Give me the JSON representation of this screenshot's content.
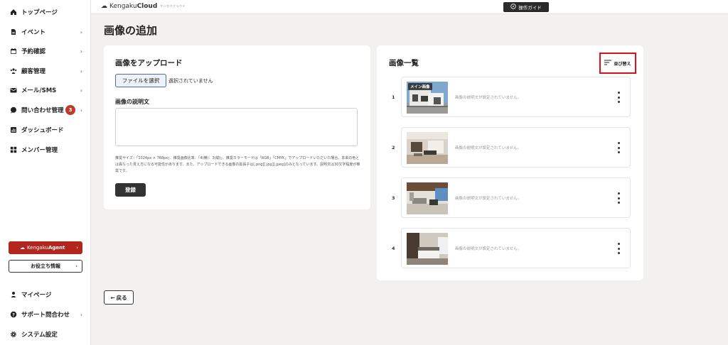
{
  "sidebar": {
    "items": [
      {
        "label": "トップページ",
        "icon": "home-icon",
        "chevron": false
      },
      {
        "label": "イベント",
        "icon": "document-icon",
        "chevron": true
      },
      {
        "label": "予約確認",
        "icon": "calendar-icon",
        "chevron": true
      },
      {
        "label": "顧客管理",
        "icon": "people-icon",
        "chevron": true
      },
      {
        "label": "メール/SMS",
        "icon": "mail-icon",
        "chevron": true
      },
      {
        "label": "問い合わせ管理",
        "icon": "chat-icon",
        "chevron": true,
        "badge": "3"
      },
      {
        "label": "ダッシュボード",
        "icon": "chart-icon",
        "chevron": false
      },
      {
        "label": "メンバー管理",
        "icon": "grid-icon",
        "chevron": false
      }
    ],
    "agent_button": {
      "prefix": "Kengaku",
      "bold": "Agent"
    },
    "info_button": "お役立ち情報",
    "bottom_items": [
      {
        "label": "マイページ",
        "icon": "person-icon",
        "chevron": false
      },
      {
        "label": "サポート問合わせ",
        "icon": "help-icon",
        "chevron": true
      },
      {
        "label": "システム設定",
        "icon": "gear-icon",
        "chevron": false
      }
    ]
  },
  "topbar": {
    "logo_prefix": "Kengaku",
    "logo_bold": "Cloud",
    "logo_sub": "ケンガククラウド",
    "guide_label": "操作ガイド"
  },
  "page": {
    "title": "画像の追加"
  },
  "upload": {
    "title": "画像をアップロード",
    "file_button": "ファイルを選択",
    "file_status": "選択されていません",
    "desc_label": "画像の説明文",
    "note": "推奨サイズ：「1024px × 768px」、推奨画像比率：「4(横)：3(縦)」、推奨カラーモードは「RGB」「CMYK」でアップロードいただいた場合、本来の色とは異なった見え方になる可能性があります。また、アップロードできる画像の拡張子は[.png][.jpg][.jpeg]のみとなっています。説明文は30文字程度が推奨です。",
    "register_button": "登録"
  },
  "image_list": {
    "title": "画像一覧",
    "sort_button": "並び替え",
    "main_tag": "メイン画像",
    "rows": [
      {
        "num": "1",
        "desc": "画像の説明文が設定されていません。"
      },
      {
        "num": "2",
        "desc": "画像の説明文が設定されていません。"
      },
      {
        "num": "3",
        "desc": "画像の説明文が設定されていません。"
      },
      {
        "num": "4",
        "desc": "画像の説明文が設定されていません。"
      }
    ]
  },
  "back_button": {
    "arrow": "←",
    "label": "戻る"
  },
  "colors": {
    "accent_red": "#b3261e",
    "highlight": "#e0101a",
    "badge": "#c0392b"
  }
}
